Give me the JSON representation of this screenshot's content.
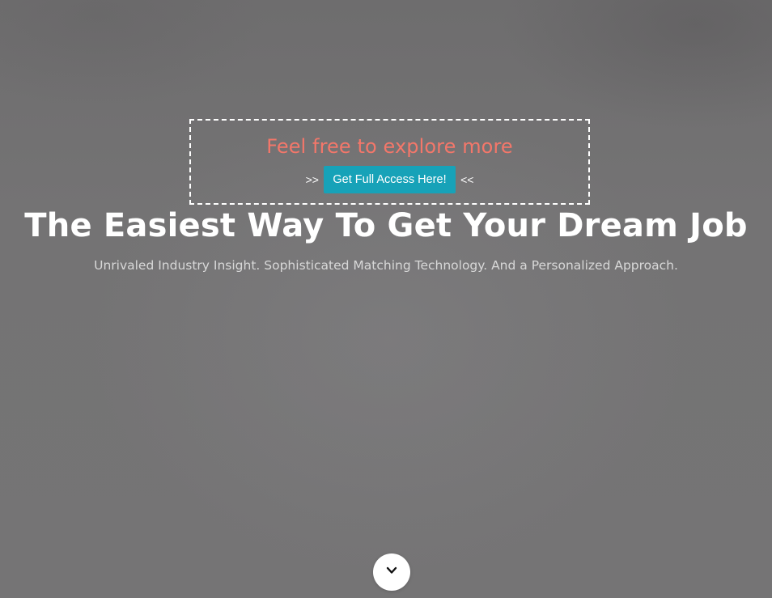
{
  "promo": {
    "title": "Feel free to explore more",
    "left_marker": ">>",
    "right_marker": "<<",
    "button_label": "Get Full Access Here!",
    "title_color": "#f3776a",
    "button_color": "#17a2b8"
  },
  "hero": {
    "headline": "The Easiest Way To Get Your Dream Job",
    "subheadline": "Unrivaled Industry Insight. Sophisticated Matching Technology. And a Personalized Approach."
  },
  "scroll": {
    "icon": "chevron-down-icon"
  }
}
